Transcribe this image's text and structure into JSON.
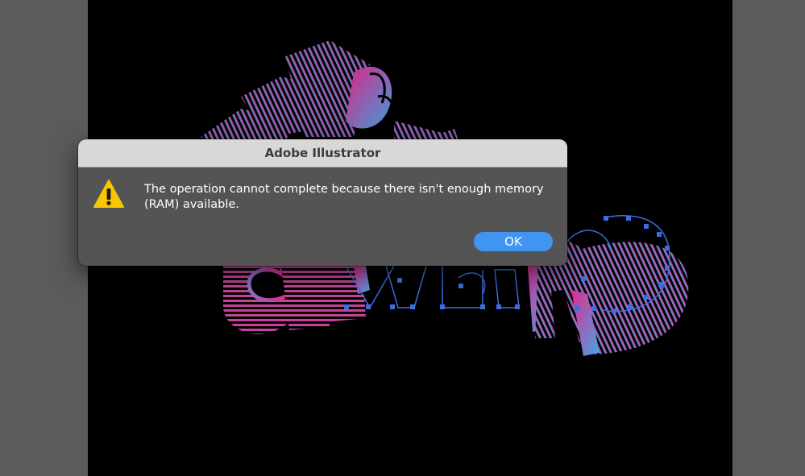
{
  "dialog": {
    "title": "Adobe Illustrator",
    "icon": "warning-icon",
    "message": "The operation cannot complete because there isn't enough memory (RAM) available.",
    "ok_label": "OK"
  },
  "colors": {
    "workspace": "#5b5b5b",
    "artboard": "#000000",
    "dialog_body": "#545454",
    "titlebar": "#d9d8d6",
    "accent": "#3f95f0",
    "warning_yellow": "#f7c600",
    "art_pink": "#e8288f",
    "art_blue": "#41a7e6",
    "selection": "#3b6fe0"
  }
}
